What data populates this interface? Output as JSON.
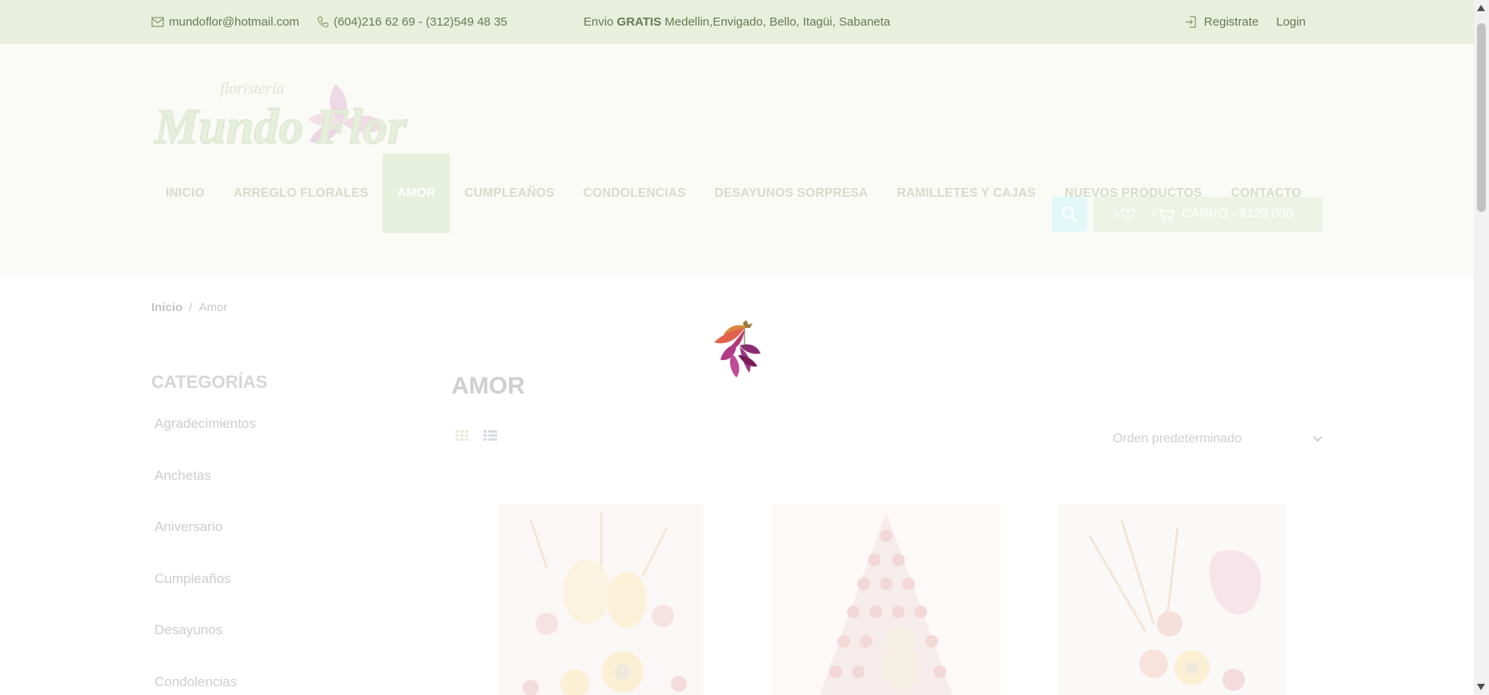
{
  "topbar": {
    "email": "mundoflor@hotmail.com",
    "phone": "(604)216 62 69 - (312)549 48 35",
    "shipping_prefix": "Envio",
    "shipping_bold": "GRATIS",
    "shipping_rest": "Medellin,Envigado, Bello, Itagüi, Sabaneta",
    "register_label": "Registrate",
    "login_label": "Login"
  },
  "header": {
    "logo_small": "floristería",
    "logo_main": "Mundo Flor",
    "nav": [
      {
        "label": "INICIO"
      },
      {
        "label": "ARREGLO FLORALES"
      },
      {
        "label": "AMOR"
      },
      {
        "label": "CUMPLEAÑOS"
      },
      {
        "label": "CONDOLENCIAS"
      },
      {
        "label": "DESAYUNOS SORPRESA"
      },
      {
        "label": "RAMILLETES Y CAJAS"
      },
      {
        "label": "NUEVOS PRODUCTOS"
      },
      {
        "label": "CONTACTO"
      }
    ],
    "wishlist_count": "0",
    "cart_count": "1",
    "cart_label": "CARRO - $129.000"
  },
  "breadcrumb": {
    "home": "Inicio",
    "separator": "/",
    "current": "Amor"
  },
  "sidebar": {
    "title": "CATEGORÍAS",
    "items": [
      {
        "label": "Agradecimientos"
      },
      {
        "label": "Anchetas"
      },
      {
        "label": "Aniversario"
      },
      {
        "label": "Cumpleaños"
      },
      {
        "label": "Desayunos"
      },
      {
        "label": "Condolencias"
      }
    ]
  },
  "main": {
    "title": "AMOR",
    "sort_label": "Orden predeterminado"
  },
  "colors": {
    "topbar_bg": "#e8efdc",
    "nav_active_bg": "#e7efdd",
    "search_bg": "#e2f8f7",
    "cart_bg": "#eef3e6"
  },
  "icons": [
    "mail-icon",
    "phone-icon",
    "login-icon",
    "search-icon",
    "heart-icon",
    "cart-icon",
    "grid-view-icon",
    "list-view-icon",
    "chevron-down-icon"
  ]
}
